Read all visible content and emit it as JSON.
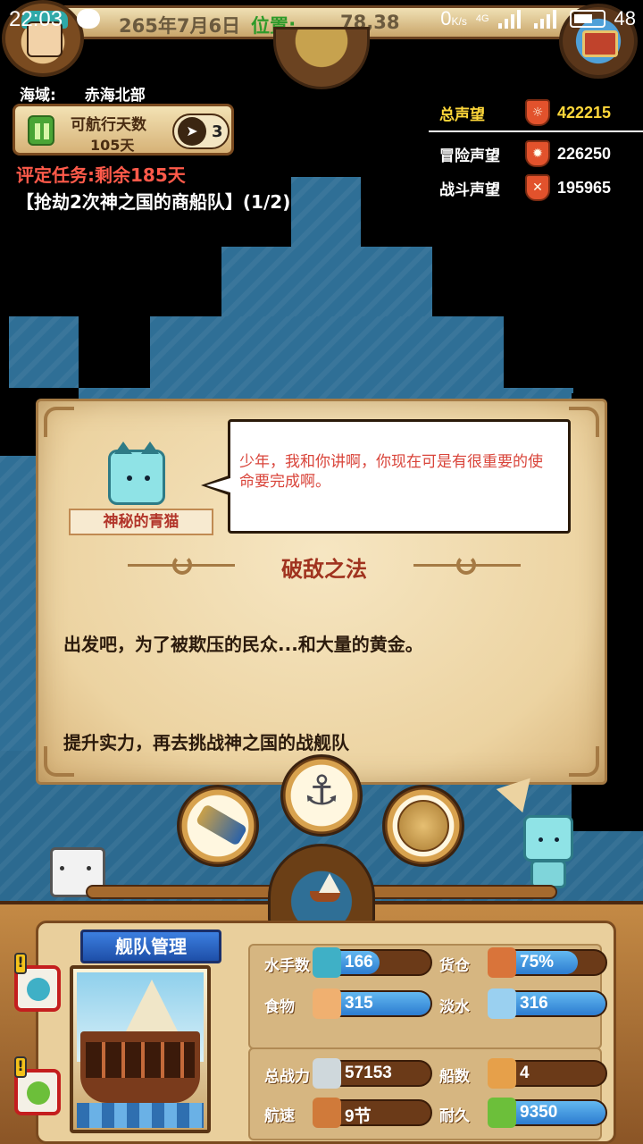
{
  "status_bar": {
    "time": "22:03",
    "speed": "0",
    "speed_unit": "K/s",
    "network": "4G",
    "battery": "48"
  },
  "top_bar": {
    "date": "265年7月6日",
    "position_label": "位置:",
    "position_value": "78,38"
  },
  "sea_area": {
    "label": "海域:",
    "value": "赤海北部"
  },
  "voyage": {
    "label": "可航行天数",
    "days": "105天",
    "speed_level": "3"
  },
  "task": {
    "remaining": "评定任务:剩余185天",
    "goal": "【抢劫2次神之国的商船队】(1/2)"
  },
  "prestige": {
    "total_label": "总声望",
    "total_value": "422215",
    "adventure_label": "冒险声望",
    "adventure_value": "226250",
    "battle_label": "战斗声望",
    "battle_value": "195965",
    "colors": {
      "total": "#ffd83a",
      "adventure": "#ffffff",
      "battle": "#ffffff"
    }
  },
  "dialog": {
    "npc_name": "神秘的青猫",
    "speech": "少年，我和你讲啊，你现在可是有很重要的使命要完成啊。",
    "title": "破敌之法",
    "body": "出发吧，为了被欺压的民众...和大量的黄金。",
    "hint": "提升实力，再去挑战神之国的战舰队"
  },
  "hud_buttons": {
    "telescope": "telescope-icon",
    "anchor": "anchor-icon",
    "map": "world-map-icon",
    "sail": "sailing-ship-icon"
  },
  "fleet": {
    "tab_label": "舰队管理",
    "stats": [
      {
        "label": "水手数",
        "value": "166",
        "icon": "sailor-icon",
        "fill": 0.55
      },
      {
        "label": "货仓",
        "value": "75%",
        "icon": "cargo-crate-icon",
        "fill": 0.75
      },
      {
        "label": "食物",
        "value": "315",
        "icon": "meat-icon",
        "fill": 1.0
      },
      {
        "label": "淡水",
        "value": "316",
        "icon": "water-jug-icon",
        "fill": 1.0
      },
      {
        "label": "总战力",
        "value": "57153",
        "icon": "crossed-swords-icon",
        "fill": 0
      },
      {
        "label": "船数",
        "value": "4",
        "icon": "ship-count-icon",
        "fill": 0
      },
      {
        "label": "航速",
        "value": "9节",
        "icon": "ship-speed-icon",
        "fill": 0
      },
      {
        "label": "耐久",
        "value": "9350",
        "icon": "durability-icon",
        "fill": 1.0
      }
    ]
  },
  "colors": {
    "sea": "#2f6f96",
    "task_red": "#ff5a4a",
    "dialog_title": "#a0331f",
    "speech_text": "#d9443a",
    "stat_bar": "#2c7cd0"
  }
}
